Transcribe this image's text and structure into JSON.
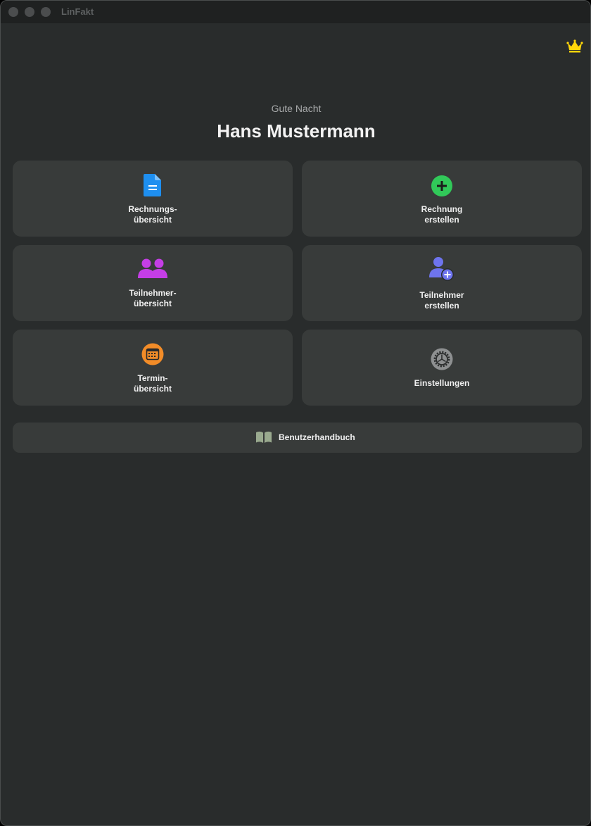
{
  "window": {
    "title": "LinFakt"
  },
  "header": {
    "greeting": "Gute Nacht",
    "user_name": "Hans Mustermann"
  },
  "tiles": [
    {
      "line1": "Rechnungs-",
      "line2": "übersicht",
      "icon": "document-icon",
      "color": "#1e8ff0"
    },
    {
      "line1": "Rechnung",
      "line2": "erstellen",
      "icon": "plus-circle-icon",
      "color": "#31c959"
    },
    {
      "line1": "Teilnehmer-",
      "line2": "übersicht",
      "icon": "people-icon",
      "color": "#c53ee6"
    },
    {
      "line1": "Teilnehmer",
      "line2": "erstellen",
      "icon": "person-add-icon",
      "color": "#6e74ee"
    },
    {
      "line1": "Termin-",
      "line2": "übersicht",
      "icon": "calendar-icon",
      "color": "#f28c28"
    },
    {
      "line1": "Einstellungen",
      "line2": "",
      "icon": "gear-icon",
      "color": "#8e9091"
    }
  ],
  "manual": {
    "label": "Benutzerhandbuch",
    "icon": "book-icon",
    "color": "#9aaa8f"
  },
  "premium": {
    "icon": "crown-icon",
    "color": "#ffd60a"
  }
}
